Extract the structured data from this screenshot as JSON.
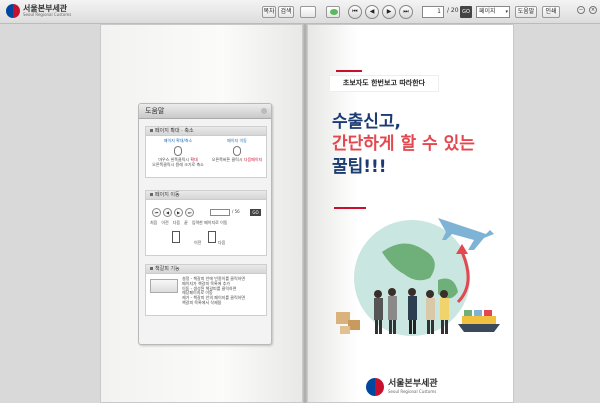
{
  "app": {
    "logo_ko": "서울본부세관",
    "logo_en": "Seoul Regional Customs"
  },
  "toolbar": {
    "btn_book": "목차",
    "btn_search": "검색",
    "page_current": "1",
    "page_total": "/ 20",
    "go_label": "GO",
    "view_select": "페이지",
    "help_label": "도움말",
    "print_label": "인쇄"
  },
  "help_panel": {
    "title": "도움말",
    "section1": {
      "title": "페이지 확대 · 축소",
      "col1_title": "페이지 확대/축소",
      "col1_text_a": "마우스 왼쪽클릭시",
      "col1_text_b": "확대",
      "col1_text_c": "오른쪽클릭시 원래 크기로 축소",
      "col2_title": "페이지 이동",
      "col2_text_a": "오른쪽버튼 클릭시",
      "col2_text_b": "다음페이지"
    },
    "section2": {
      "title": "페이지 이동",
      "page_value": "",
      "page_total": "/ 56",
      "go_label": "GO",
      "labels": [
        "처음",
        "이전",
        "다음",
        "끝",
        "입력한 페이지로 이동"
      ],
      "prev_label": "이전",
      "next_label": "다음"
    },
    "section3": {
      "title": "책갈피 기능",
      "lines": [
        "설정 - 책갈피 안에 빈종이를 클릭하면",
        "페이지가 책갈피 목록에 추가",
        "이동 - 생성된 책갈피를 클릭하면",
        "해당페이지로 이동",
        "제거 - 책갈피 안의 페이지를 클릭하면",
        "책갈피 목록에서 삭제됨"
      ]
    }
  },
  "cover": {
    "tag": "초보자도 한번보고 따라한다",
    "headline_1": "수출신고,",
    "headline_2": "간단하게 할 수 있는",
    "headline_3": "꿀팁!!!",
    "logo_ko": "서울본부세관",
    "logo_en": "Seoul Regional Customs"
  },
  "colors": {
    "navy": "#1d3b73",
    "red": "#e3474f",
    "brand_red": "#c8102e",
    "brand_blue": "#0047a0"
  }
}
